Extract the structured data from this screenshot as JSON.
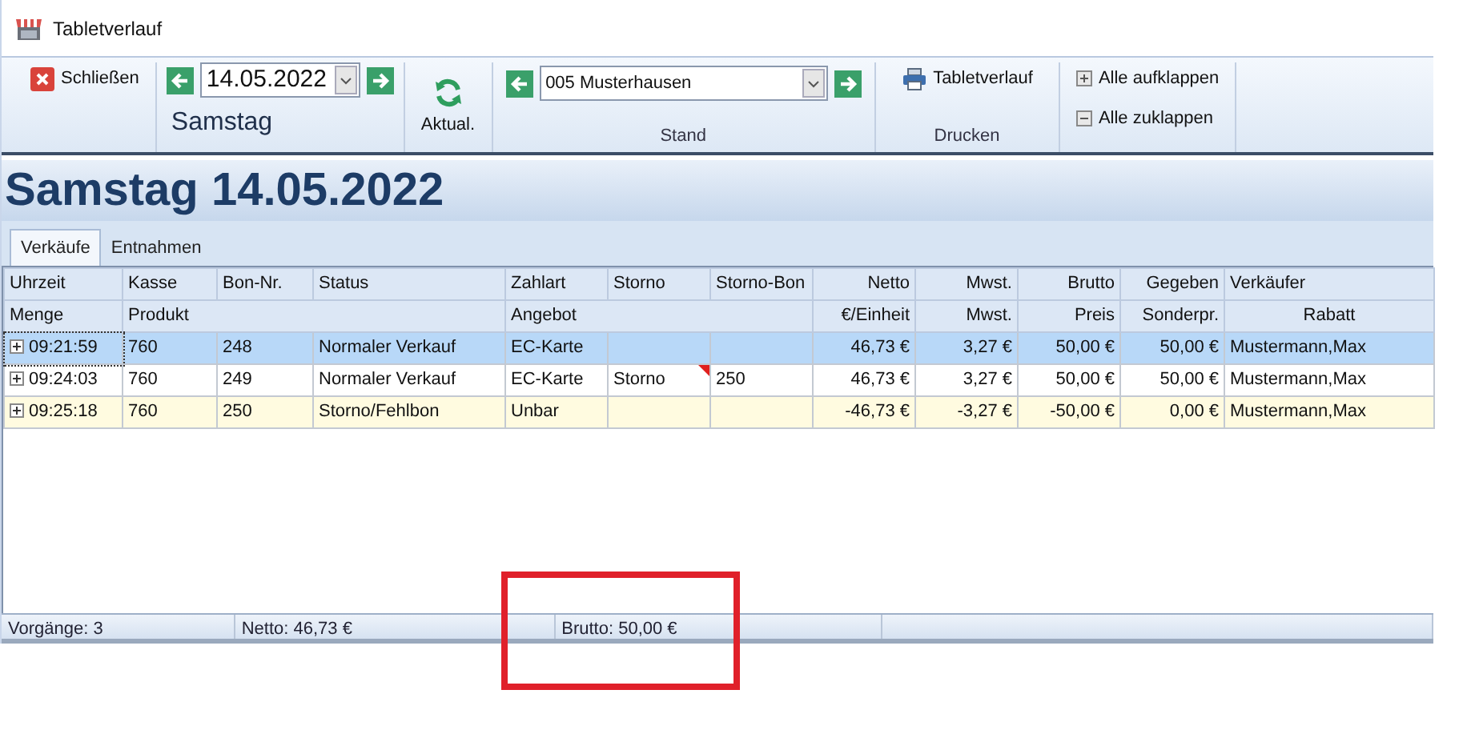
{
  "window": {
    "title": "Tabletverlauf"
  },
  "ribbon": {
    "close_button": "Schließen",
    "date": {
      "value": "14.05.2022",
      "weekday": "Samstag"
    },
    "refresh_button": "Aktual.",
    "stand": {
      "value": "005 Musterhausen",
      "group_label": "Stand"
    },
    "print": {
      "button": "Tabletverlauf",
      "group_label": "Drucken"
    },
    "expand_all": "Alle aufklappen",
    "collapse_all": "Alle zuklappen"
  },
  "heading": "Samstag 14.05.2022",
  "tabs": [
    {
      "label": "Verkäufe",
      "selected": true
    },
    {
      "label": "Entnahmen",
      "selected": false
    }
  ],
  "table": {
    "columns": [
      "Uhrzeit",
      "Kasse",
      "Bon-Nr.",
      "Status",
      "Zahlart",
      "Storno",
      "Storno-Bon",
      "Netto",
      "Mwst.",
      "Brutto",
      "Gegeben",
      "Verkäufer"
    ],
    "subcolumns": [
      "Menge",
      "Produkt",
      "Angebot",
      "€/Einheit",
      "Mwst.",
      "Preis",
      "Sonderpr.",
      "Rabatt"
    ],
    "rows": [
      {
        "kind": "sale",
        "selected": true,
        "expanded": false,
        "note": false,
        "cells": [
          "09:21:59",
          "760",
          "248",
          "Normaler Verkauf",
          "EC-Karte",
          null,
          null,
          "46,73 €",
          "3,27 €",
          "50,00 €",
          "50,00 €",
          "Mustermann,Max"
        ]
      },
      {
        "kind": "sale",
        "selected": false,
        "expanded": false,
        "note": true,
        "cells": [
          "09:24:03",
          "760",
          "249",
          "Normaler Verkauf",
          "EC-Karte",
          "Storno",
          "250",
          "46,73 €",
          "3,27 €",
          "50,00 €",
          "50,00 €",
          "Mustermann,Max"
        ]
      },
      {
        "kind": "void",
        "selected": false,
        "expanded": false,
        "note": false,
        "cells": [
          "09:25:18",
          "760",
          "250",
          "Storno/Fehlbon",
          "Unbar",
          null,
          null,
          "-46,73 €",
          "-3,27 €",
          "-50,00 €",
          "0,00 €",
          "Mustermann,Max"
        ]
      }
    ]
  },
  "status_bar": [
    "Vorgänge: 3",
    "Netto: 46,73 €",
    "Brutto: 50,00 €"
  ],
  "annotation": {
    "kind": "rectangle"
  }
}
